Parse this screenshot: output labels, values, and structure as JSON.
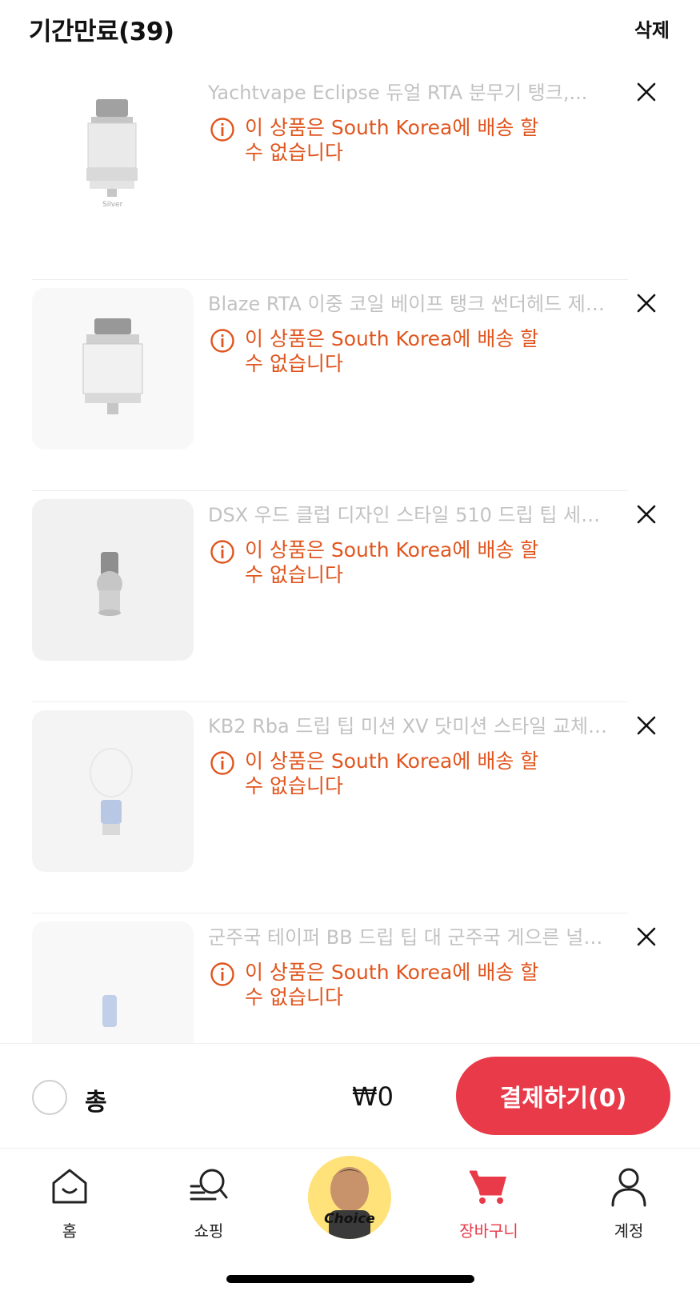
{
  "header": {
    "title": "기간만료(39)",
    "delete_label": "삭제"
  },
  "items": [
    {
      "name": "Yachtvape Eclipse 듀얼 RTA 분무기 탱크,...",
      "warning": "이 상품은 South Korea에 배송 할 수 없습니다",
      "image_label": "Silver"
    },
    {
      "name": "Blaze RTA 이중 코일 베이프 탱크 썬더헤드 제…",
      "warning": "이 상품은 South Korea에 배송 할 수 없습니다"
    },
    {
      "name": "DSX 우드 클럽 디자인 스타일 510 드립 팁 세…",
      "warning": "이 상품은 South Korea에 배송 할 수 없습니다"
    },
    {
      "name": "KB2 Rba 드립 팁 미션 XV 닷미션 스타일 교체…",
      "warning": "이 상품은 South Korea에 배송 할 수 없습니다"
    },
    {
      "name": "군주국 테이퍼 BB 드립 팁 대 군주국 게으른 널…",
      "warning": "이 상품은 South Korea에 배송 할 수 없습니다"
    }
  ],
  "checkout": {
    "total_label": "총",
    "total_value": "₩0",
    "pay_label": "결제하기(0)"
  },
  "tabbar": {
    "tabs": [
      {
        "label": "홈",
        "icon": "home-icon"
      },
      {
        "label": "쇼핑",
        "icon": "search-list-icon"
      },
      {
        "label": "Choice",
        "icon": "choice-badge"
      },
      {
        "label": "장바구니",
        "icon": "cart-icon",
        "active": true
      },
      {
        "label": "계정",
        "icon": "account-icon"
      }
    ]
  },
  "colors": {
    "accent": "#e83a49",
    "warning": "#e0551e",
    "muted_text": "#c2c2c2"
  }
}
